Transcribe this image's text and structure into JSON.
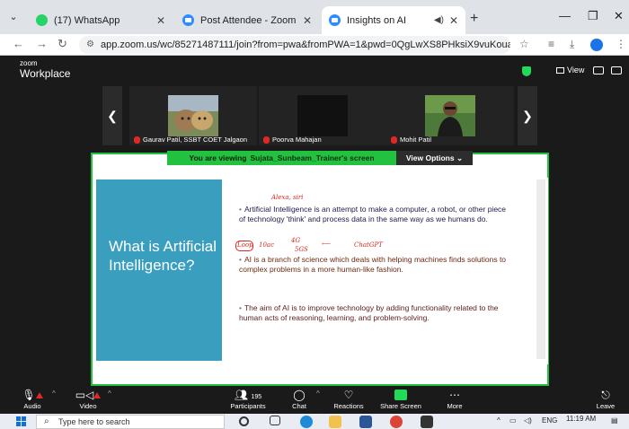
{
  "browser": {
    "tabs": [
      {
        "title": "(17) WhatsApp",
        "icon": "whatsapp-icon"
      },
      {
        "title": "Post Attendee - Zoom",
        "icon": "zoom-icon"
      },
      {
        "title": "Insights on AI",
        "icon": "zoom-icon",
        "active": true
      }
    ],
    "url": "app.zoom.us/wc/85271487111/join?from=pwa&fromPWA=1&pwd=0QgLwXS8PHksiX9vuKoua3uSXjmJFx.1"
  },
  "zoom": {
    "logo_small": "zoom",
    "logo_big": "Workplace",
    "view_label": "View",
    "participants": [
      {
        "name": "Gaurav Patil, SSBT COET Jalgaon",
        "muted": true
      },
      {
        "name": "Poorva Mahajan",
        "muted": true
      },
      {
        "name": "Mohit Patil",
        "muted": true
      }
    ],
    "viewing_prefix": "You are viewing",
    "viewing_name": "Sujata_Sunbeam_Trainer's screen",
    "view_options": "View Options",
    "toolbar": {
      "audio": "Audio",
      "video": "Video",
      "participants": "Participants",
      "participants_count": "195",
      "chat": "Chat",
      "reactions": "Reactions",
      "share_screen": "Share Screen",
      "more": "More",
      "leave": "Leave"
    }
  },
  "slide": {
    "title": "What is Artificial Intelligence?",
    "bullets": [
      "Artificial Intelligence is an attempt to make a computer, a robot, or other piece of technology 'think' and process data in the same way as we humans do.",
      "AI is a branch of science which deals with helping machines finds solutions to complex problems in a more human-like fashion.",
      "The aim of AI is to improve technology by adding functionality related to the human acts of reasoning, learning, and problem-solving."
    ],
    "annotations": {
      "top": "Alexa, siri",
      "left_box": "Loop",
      "count": "10ac",
      "v1": "4G",
      "v2": "5GS",
      "chatgpt": "ChatGPT"
    },
    "colors": {
      "title_panel": "#3a9fbf",
      "annotation": "#d8271c"
    }
  },
  "taskbar": {
    "search_placeholder": "Type here to search",
    "lang": "ENG",
    "time": "11:19 AM"
  }
}
